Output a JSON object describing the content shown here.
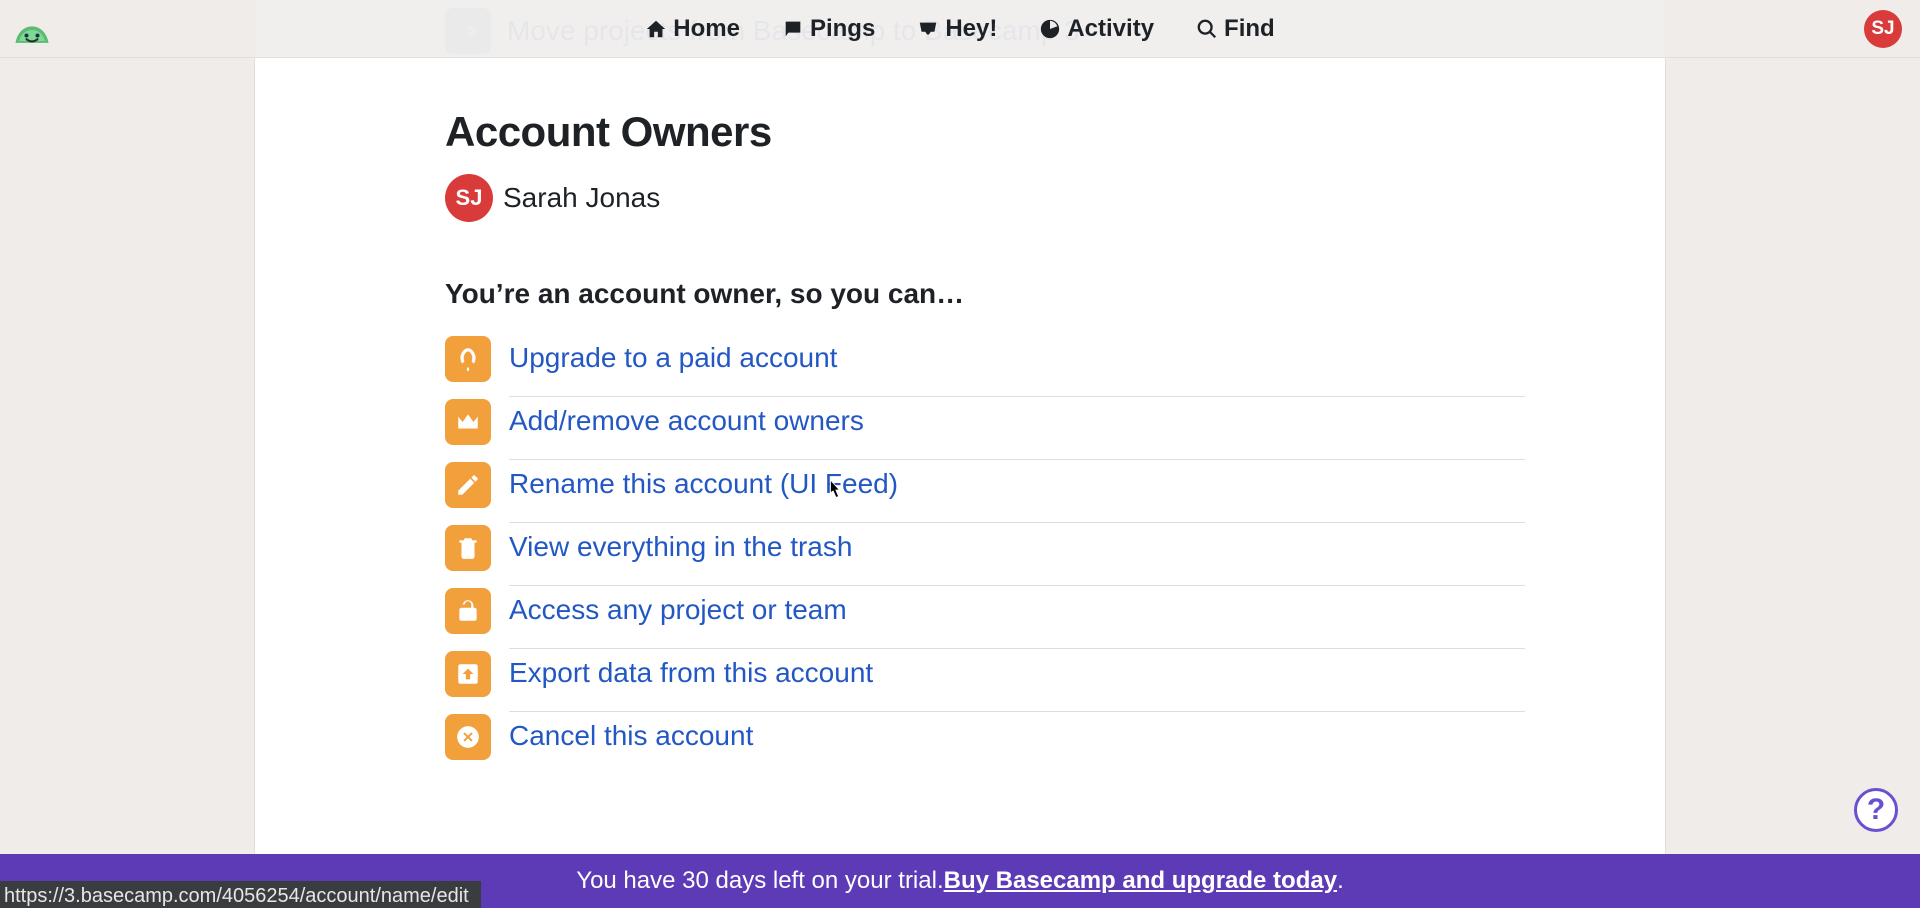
{
  "nav": {
    "home": "Home",
    "pings": "Pings",
    "hey": "Hey!",
    "activity": "Activity",
    "find": "Find"
  },
  "user": {
    "initials": "SJ",
    "name": "Sarah Jonas"
  },
  "ghost_row": "Move projects from Basecamp to Basecamp 3",
  "page_title": "Account Owners",
  "sub_heading": "You’re an account owner, so you can…",
  "actions": {
    "upgrade": "Upgrade to a paid account",
    "owners": "Add/remove account owners",
    "rename": "Rename this account (UI Feed)",
    "trash": "View everything in the trash",
    "access": "Access any project or team",
    "export": "Export data from this account",
    "cancel": "Cancel this account"
  },
  "trial": {
    "prefix": "You have 30 days left on your trial. ",
    "link": "Buy Basecamp and upgrade today",
    "suffix": "."
  },
  "status_url": "https://3.basecamp.com/4056254/account/name/edit",
  "help": "?"
}
